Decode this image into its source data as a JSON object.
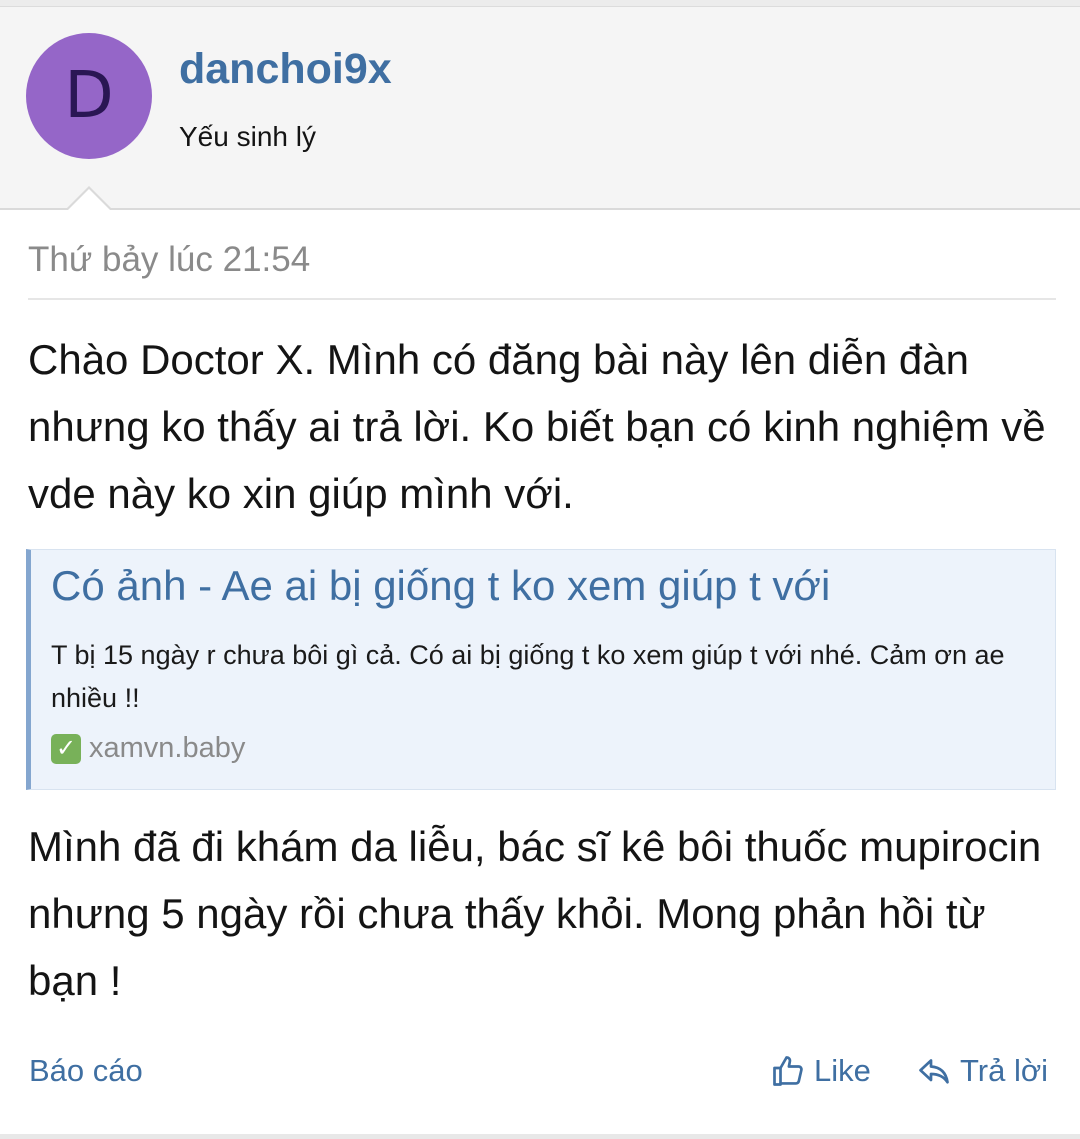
{
  "post": {
    "author": {
      "avatar_letter": "D",
      "avatar_color": "#9566c8",
      "username": "danchoi9x",
      "user_title": "Yếu sinh lý"
    },
    "date": "Thứ bảy lúc 21:54",
    "message_intro": "Chào Doctor X. Mình có đăng bài này lên diễn đàn nhưng ko thấy ai trả lời. Ko biết bạn có kinh nghiệm về vde này ko xin giúp mình với.",
    "embed": {
      "title": "Có ảnh - Ae ai bị giống t ko xem giúp t với",
      "description": "T bị 15 ngày r chưa bôi gì cả. Có ai bị giống t ko xem giúp t với nhé. Cảm ơn ae nhiều !!",
      "source": "xamvn.baby",
      "source_icon": "check-mark-icon"
    },
    "message_followup": "Mình đã đi khám da liễu, bác sĩ kê bôi thuốc mupirocin nhưng 5 ngày rồi chưa thấy khỏi. Mong phản hồi từ bạn !"
  },
  "actions": {
    "report_label": "Báo cáo",
    "like_label": "Like",
    "reply_label": "Trả lời"
  },
  "colors": {
    "accent": "#3f6fa2",
    "header_bg": "#f5f5f5",
    "embed_bg": "#edf3fb",
    "embed_border": "#84a6cf",
    "muted_text": "#8a8a8a"
  }
}
